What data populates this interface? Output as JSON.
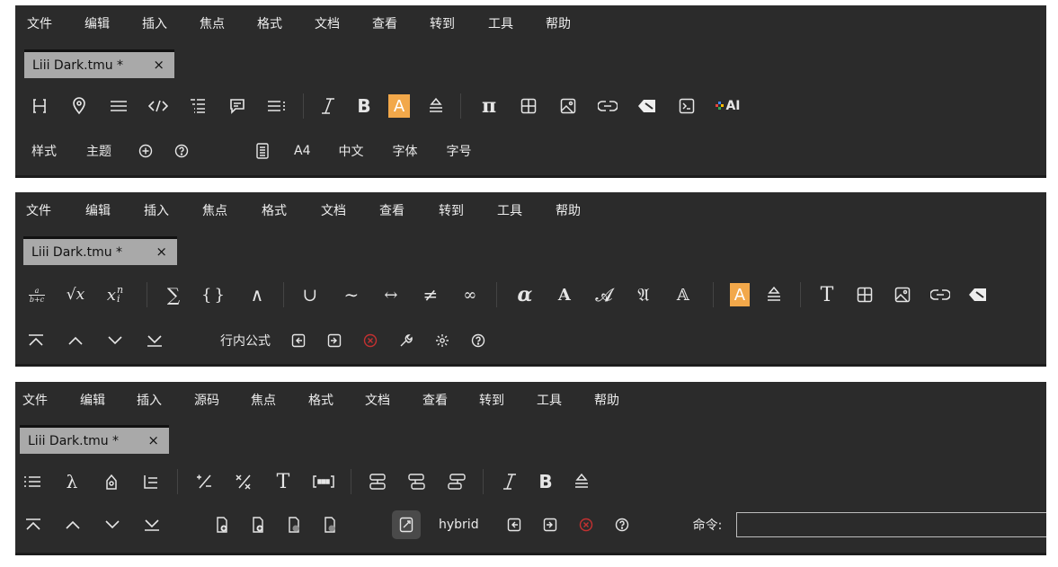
{
  "panel1": {
    "menu": [
      "文件",
      "编辑",
      "插入",
      "焦点",
      "格式",
      "文档",
      "查看",
      "转到",
      "工具",
      "帮助"
    ],
    "tab": {
      "title": "Liii Dark.tmu *",
      "close": "×"
    },
    "toolbar": {
      "bold": "B",
      "highlight": "A",
      "pi": "π",
      "ai": "AI"
    },
    "bottom": {
      "style": "样式",
      "theme": "主题",
      "paper": "A4",
      "lang": "中文",
      "font": "字体",
      "size": "字号"
    }
  },
  "panel2": {
    "menu": [
      "文件",
      "编辑",
      "插入",
      "焦点",
      "格式",
      "文档",
      "查看",
      "转到",
      "工具",
      "帮助"
    ],
    "tab": {
      "title": "Liii Dark.tmu *",
      "close": "×"
    },
    "math": {
      "frac_num": "a",
      "frac_den": "b+c",
      "sqrt": "√x",
      "script": "x",
      "sup": "n",
      "sub": "i",
      "sum": "∑",
      "braces": "{}",
      "wedge": "∧",
      "cup": "∪",
      "tilde": "∼",
      "lrarrow": "↔",
      "neq": "≠",
      "infty": "∞",
      "alpha": "α",
      "bold_a": "A",
      "cal_a": "𝓐",
      "frak_a": "𝔄",
      "bb_a": "𝔸",
      "highlight": "A",
      "text_t": "T"
    },
    "bottom": {
      "inline_formula": "行内公式"
    }
  },
  "panel3": {
    "menu": [
      "文件",
      "编辑",
      "插入",
      "源码",
      "焦点",
      "格式",
      "文档",
      "查看",
      "转到",
      "工具",
      "帮助"
    ],
    "tab": {
      "title": "Liii Dark.tmu *",
      "close": "×"
    },
    "toolbar": {
      "lambda": "λ",
      "text_t": "T",
      "bold": "B"
    },
    "bottom": {
      "mode": "hybrid",
      "command_label": "命令:",
      "command_value": ""
    }
  }
}
